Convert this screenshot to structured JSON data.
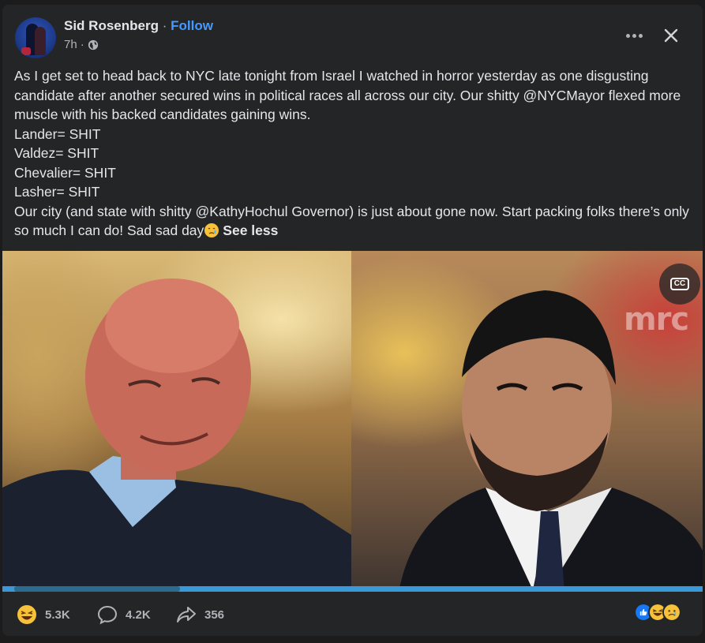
{
  "post": {
    "author": "Sid Rosenberg",
    "separator": "·",
    "follow_label": "Follow",
    "time": "7h",
    "time_separator": "·",
    "audience_icon": "globe-icon",
    "more_icon": "more-horizontal-icon",
    "close_icon": "close-icon",
    "body_lines": [
      "As I get set to head back to NYC late tonight from Israel I watched in horror yesterday as one disgusting candidate after another secured wins in political races all across our city. Our shitty @NYCMayor flexed more muscle with his backed candidates gaining wins.",
      "Lander= SHIT",
      "Valdez= SHIT",
      "Chevalier= SHIT",
      "Lasher= SHIT",
      "Our city (and state with shitty @KathyHochul Governor) is just about gone now. Start packing folks there’s only so much I can do! Sad sad day"
    ],
    "body_end_emoji": "crying-face-icon",
    "see_less_label": "See less"
  },
  "media": {
    "cc_label": "CC",
    "watermark": "mrc",
    "colors": {
      "progress": "#3a9ad9"
    }
  },
  "footer": {
    "reactions_count": "5.3K",
    "reaction_icon": "laughing-face-icon",
    "comments_count": "4.2K",
    "comment_icon": "comment-icon",
    "shares_count": "356",
    "share_icon": "share-icon",
    "reaction_summary": [
      "like-icon",
      "laughing-face-icon",
      "sad-face-icon"
    ]
  },
  "colors": {
    "background": "#242526",
    "text": "#e4e6eb",
    "secondary_text": "#b0b3b8",
    "link": "#4599ff"
  }
}
